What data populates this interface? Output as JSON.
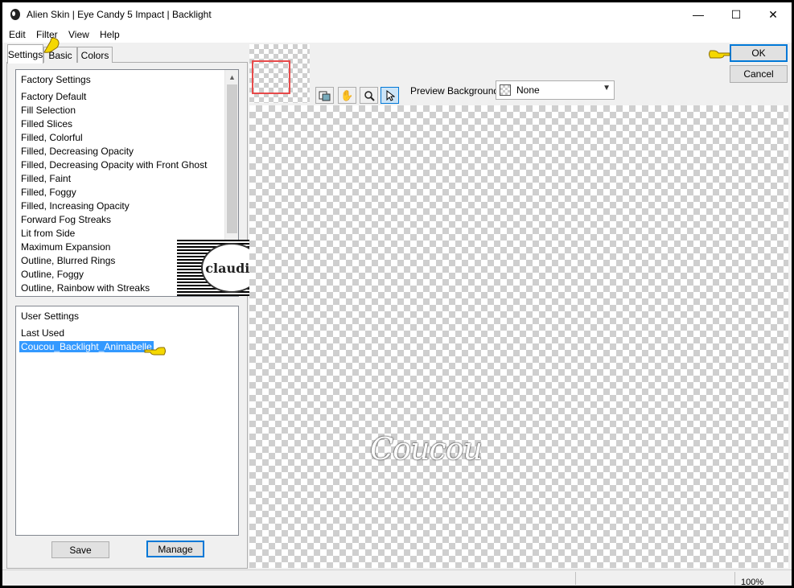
{
  "window": {
    "title": "Alien Skin | Eye Candy 5 Impact | Backlight",
    "minimize": "—",
    "maximize": "☐",
    "close": "✕"
  },
  "menu": {
    "edit": "Edit",
    "filter": "Filter",
    "view": "View",
    "help": "Help"
  },
  "tabs": {
    "settings": "Settings",
    "basic": "Basic",
    "colors": "Colors"
  },
  "factory": {
    "header": "Factory Settings",
    "items": [
      "Factory Default",
      "Fill Selection",
      "Filled Slices",
      "Filled, Colorful",
      "Filled, Decreasing Opacity",
      "Filled, Decreasing Opacity with Front Ghost",
      "Filled, Faint",
      "Filled, Foggy",
      "Filled, Increasing Opacity",
      "Forward Fog Streaks",
      "Lit from Side",
      "Maximum Expansion",
      "Outline, Blurred Rings",
      "Outline, Foggy",
      "Outline, Rainbow with Streaks"
    ]
  },
  "user": {
    "header": "User Settings",
    "last_used": "Last Used",
    "selected": "Coucou_Backlight_Animabelle"
  },
  "buttons": {
    "save": "Save",
    "manage": "Manage",
    "ok": "OK",
    "cancel": "Cancel"
  },
  "preview_background": {
    "label": "Preview Background:",
    "value": "None"
  },
  "watermark": {
    "text": "claudia"
  },
  "preview": {
    "text": "Coucou"
  },
  "status": {
    "zoom": "100%"
  },
  "colors": {
    "selection": "#3399ff",
    "accent": "#0078d7",
    "pointer": "#f5d800"
  }
}
